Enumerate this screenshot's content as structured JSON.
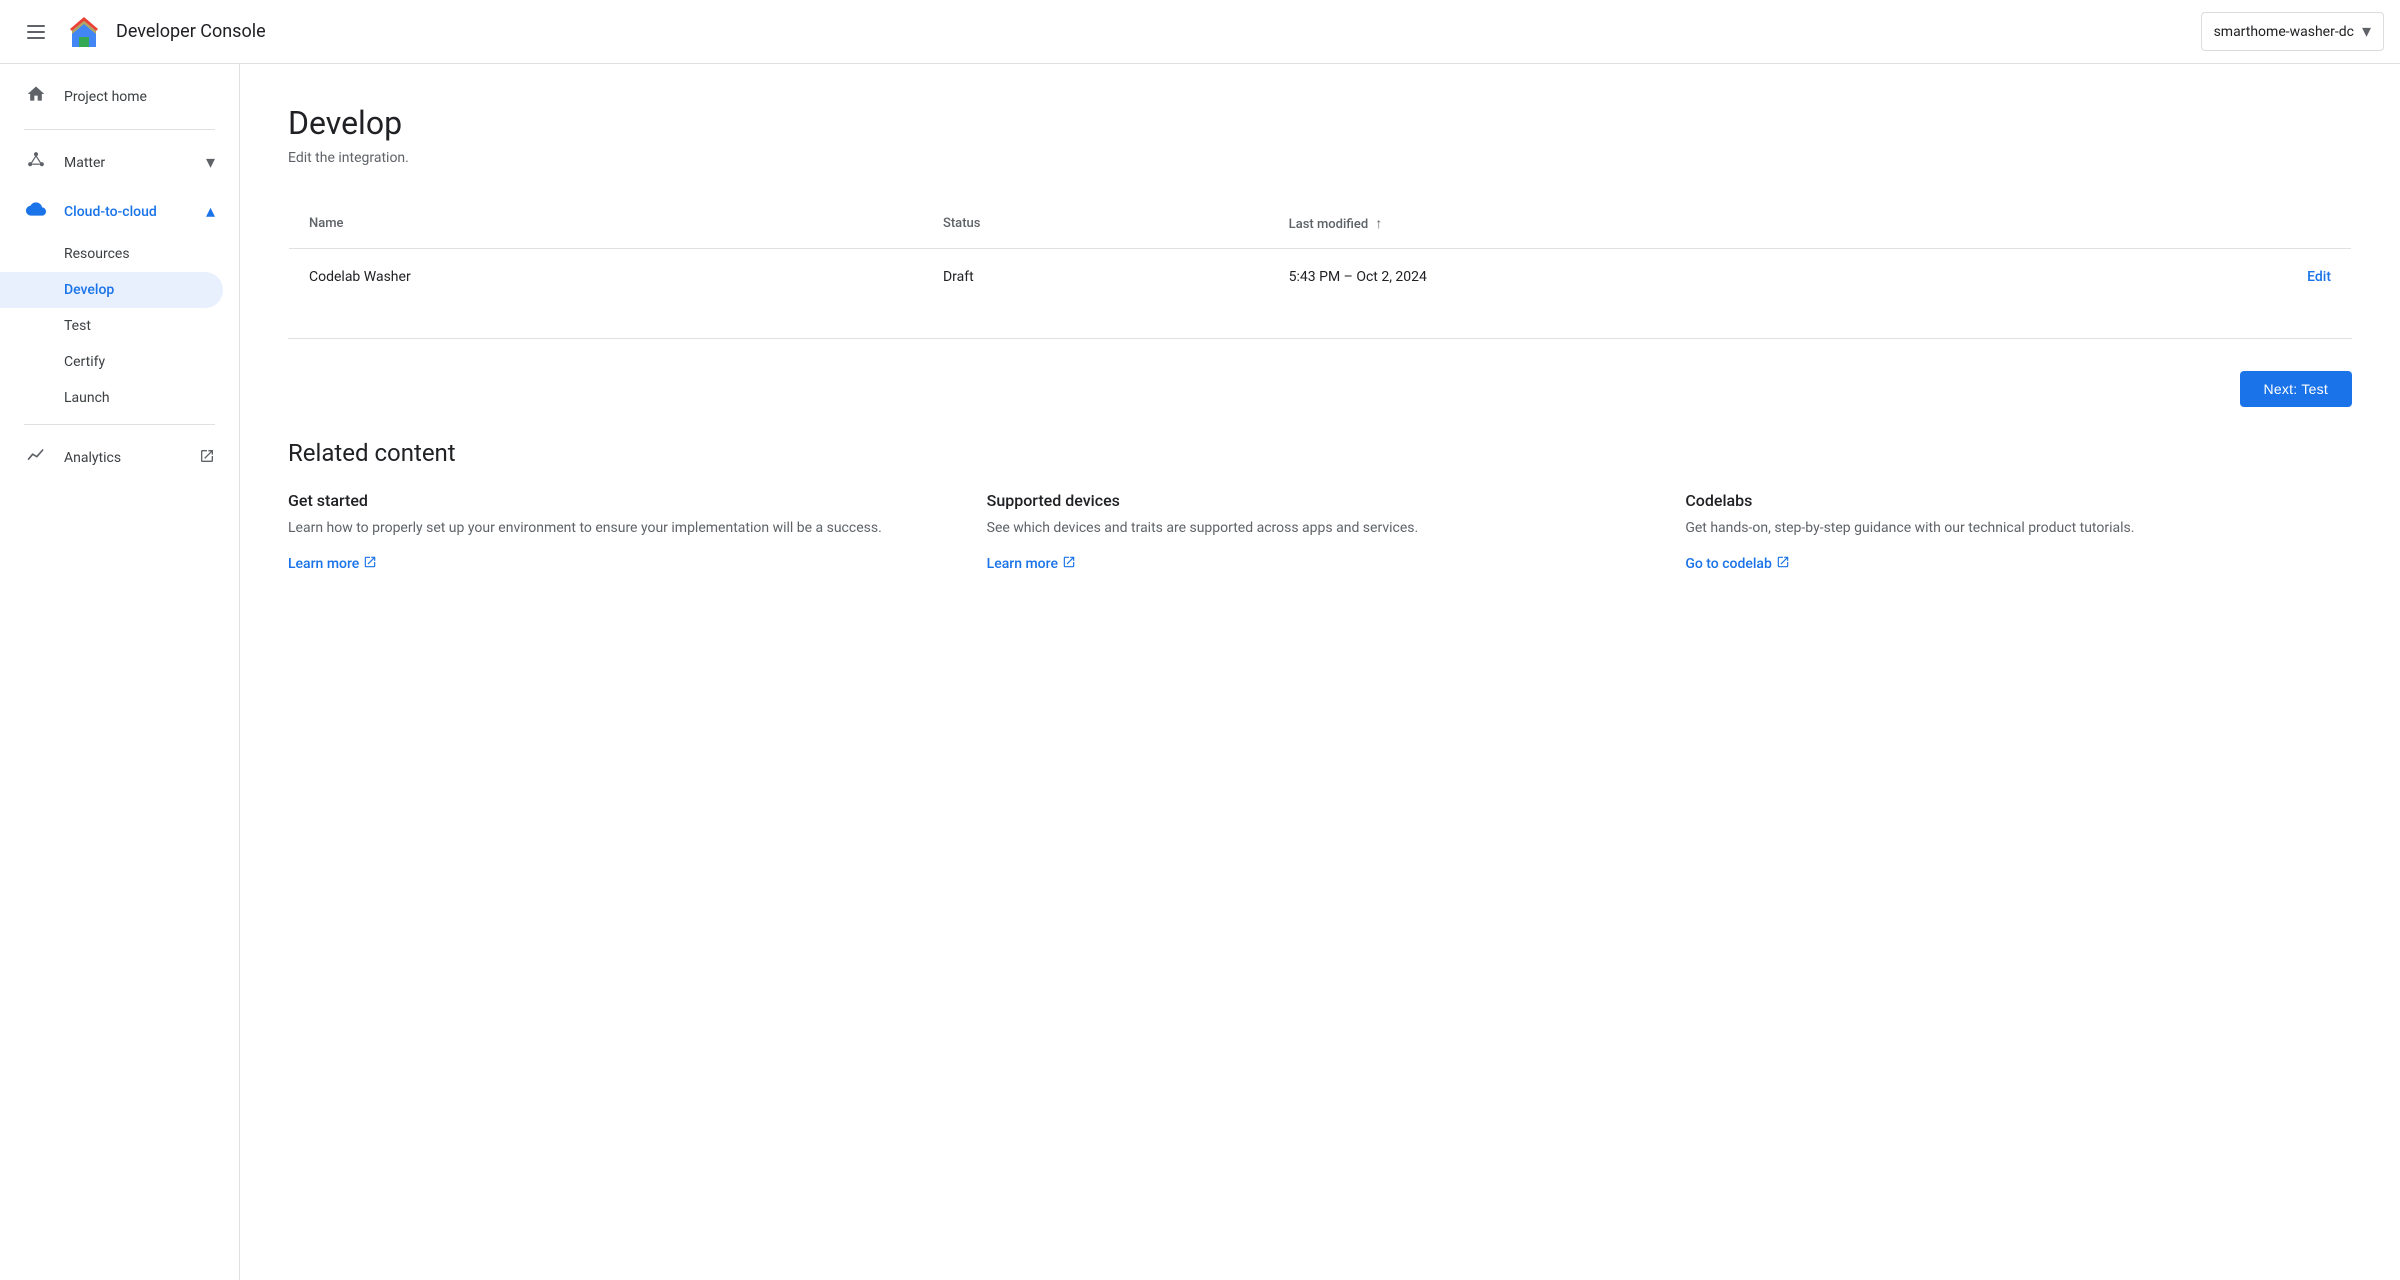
{
  "header": {
    "menu_label": "Menu",
    "title": "Developer Console",
    "project_selector": {
      "label": "smarthome-washer-dc",
      "dropdown_icon": "▾"
    }
  },
  "sidebar": {
    "project_home_label": "Project home",
    "matter_label": "Matter",
    "cloud_to_cloud_label": "Cloud-to-cloud",
    "resources_label": "Resources",
    "develop_label": "Develop",
    "test_label": "Test",
    "certify_label": "Certify",
    "launch_label": "Launch",
    "analytics_label": "Analytics"
  },
  "page": {
    "title": "Develop",
    "subtitle": "Edit the integration.",
    "table": {
      "col_name": "Name",
      "col_status": "Status",
      "col_last_modified": "Last modified",
      "sort_icon": "↑",
      "row": {
        "name": "Codelab Washer",
        "status": "Draft",
        "last_modified": "5:43 PM – Oct 2, 2024",
        "edit_label": "Edit"
      }
    },
    "next_button_label": "Next: Test"
  },
  "related_content": {
    "section_title": "Related content",
    "cards": [
      {
        "title": "Get started",
        "description": "Learn how to properly set up your environment to ensure your implementation will be a success.",
        "link_label": "Learn more"
      },
      {
        "title": "Supported devices",
        "description": "See which devices and traits are supported across apps and services.",
        "link_label": "Learn more"
      },
      {
        "title": "Codelabs",
        "description": "Get hands-on, step-by-step guidance with our technical product tutorials.",
        "link_label": "Go to codelab"
      }
    ]
  }
}
